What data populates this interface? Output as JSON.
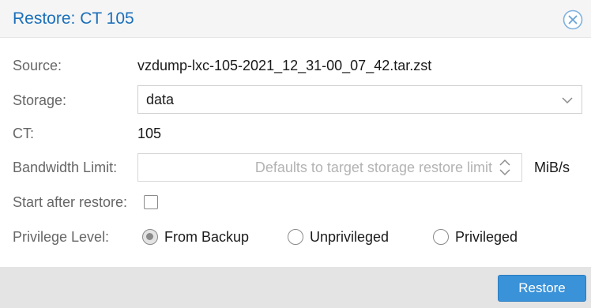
{
  "dialog": {
    "title": "Restore: CT 105",
    "close_icon": "close-circle-icon"
  },
  "form": {
    "source": {
      "label": "Source:",
      "value": "vzdump-lxc-105-2021_12_31-00_07_42.tar.zst"
    },
    "storage": {
      "label": "Storage:",
      "value": "data",
      "icon": "chevron-down-icon"
    },
    "ct": {
      "label": "CT:",
      "value": "105"
    },
    "bandwidth": {
      "label": "Bandwidth Limit:",
      "value": "",
      "placeholder": "Defaults to target storage restore limit",
      "unit": "MiB/s",
      "icon": "spinner-icon"
    },
    "start_after_restore": {
      "label": "Start after restore:",
      "checked": false
    },
    "privilege": {
      "label": "Privilege Level:",
      "options": [
        {
          "label": "From Backup",
          "checked": true
        },
        {
          "label": "Unprivileged",
          "checked": false
        },
        {
          "label": "Privileged",
          "checked": false
        }
      ]
    }
  },
  "footer": {
    "restore_label": "Restore",
    "accent": "#3a92d8"
  },
  "colors": {
    "title": "#1a6fba",
    "label": "#666666",
    "footer_bg": "#e4e4e4"
  }
}
